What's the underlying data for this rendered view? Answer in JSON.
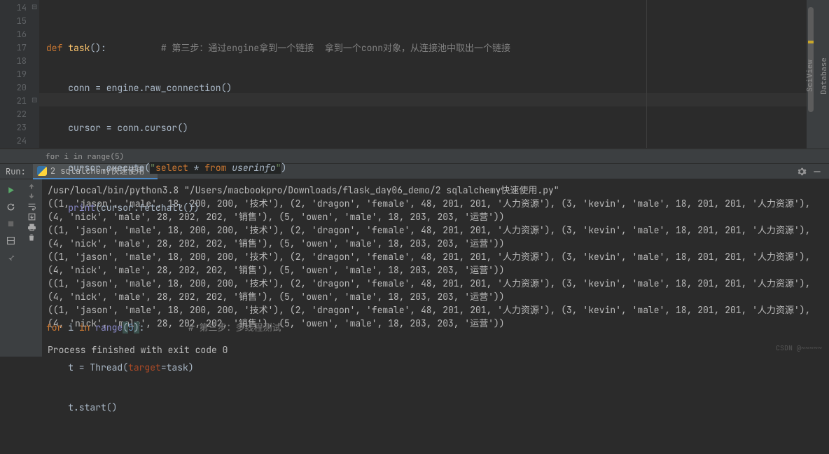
{
  "editor": {
    "lines": [
      "14",
      "15",
      "16",
      "17",
      "18",
      "19",
      "20",
      "21",
      "22",
      "23",
      "24"
    ],
    "caret_line_index": 7,
    "code": {
      "l14": {
        "kw": "def ",
        "fn": "task",
        "rest": "():",
        "indent_comment": "          # 第三步：通过engine拿到一个链接  拿到一个conn对象，从连接池中取出一个链接"
      },
      "l15": "    conn = engine.raw_connection()",
      "l16": "    cursor = conn.cursor()",
      "l17": {
        "a": "    cursor.execute(",
        "q1": "\"",
        "s1": "select ",
        "star": "*",
        "s2": " from ",
        "tbl": "userinfo",
        "q2": "\"",
        "b": ")"
      },
      "l18": {
        "a": "    ",
        "print": "print",
        "b": "(cursor.fetchall())"
      },
      "l21": {
        "kw1": "for ",
        "i": "i ",
        "kw2": "in ",
        "range": "range",
        "p1": "(",
        "n": "5",
        "p2": ")",
        "colon": ":",
        "comment": "        # 第三步：多线程测试"
      },
      "l22": {
        "a": "    t = Thread(",
        "p": "target",
        "b": "=task)"
      },
      "l23": "    t.start()"
    }
  },
  "breadcrumb": "for i in range(5)",
  "run": {
    "label": "Run:",
    "tab": "2 sqlalchemy快速使用"
  },
  "console": {
    "cmd": "/usr/local/bin/python3.8 \"/Users/macbookpro/Downloads/flask_day06_demo/2 sqlalchemy快速使用.py\"",
    "row": "((1, 'jason', 'male', 18, 200, 200, '技术'), (2, 'dragon', 'female', 48, 201, 201, '人力资源'), (3, 'kevin', 'male', 18, 201, 201, '人力资源'), (4, 'nick', 'male', 28, 202, 202, '销售'), (5, 'owen', 'male', 18, 203, 203, '运营'))",
    "exit": "Process finished with exit code 0"
  },
  "sidebar": {
    "db": "Database",
    "sci": "SciView"
  },
  "watermark": "CSDN @~~~~~"
}
